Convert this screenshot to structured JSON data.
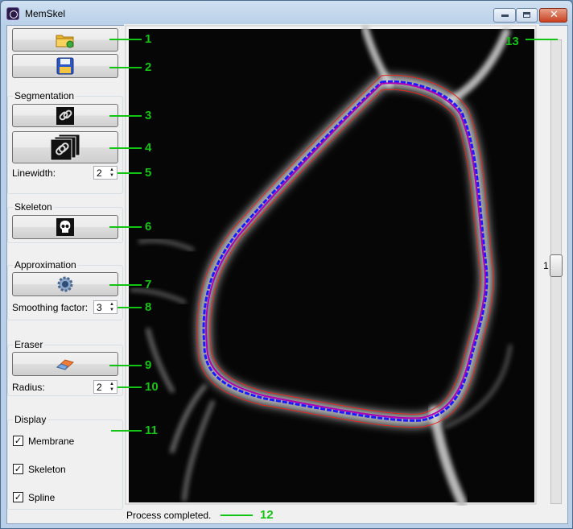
{
  "window": {
    "title": "MemSkel"
  },
  "sections": {
    "segmentation": "Segmentation",
    "skeleton": "Skeleton",
    "approximation": "Approximation",
    "eraser": "Eraser",
    "display": "Display"
  },
  "fields": {
    "linewidth": {
      "label": "Linewidth:",
      "value": "2"
    },
    "smoothing": {
      "label": "Smoothing factor:",
      "value": "3"
    },
    "radius": {
      "label": "Radius:",
      "value": "2"
    }
  },
  "display_options": [
    {
      "label": "Membrane",
      "checked": true
    },
    {
      "label": "Skeleton",
      "checked": true
    },
    {
      "label": "Spline",
      "checked": true
    }
  ],
  "icons": {
    "open": "open-folder-icon",
    "save": "floppy-disk-icon",
    "segment": "chain-link-icon",
    "segment_all": "chain-link-stack-icon",
    "skeleton": "skull-icon",
    "approximate": "gear-icon",
    "eraser": "eraser-icon"
  },
  "slider": {
    "value": "1"
  },
  "status": "Process completed.",
  "annotations": [
    "1",
    "2",
    "3",
    "4",
    "5",
    "6",
    "7",
    "8",
    "9",
    "10",
    "11",
    "12",
    "13"
  ],
  "colors": {
    "annotation": "#14c414",
    "membrane_outline": "#e8241c",
    "skeleton_line": "#1a1aff",
    "spline_line": "#b000b0"
  }
}
